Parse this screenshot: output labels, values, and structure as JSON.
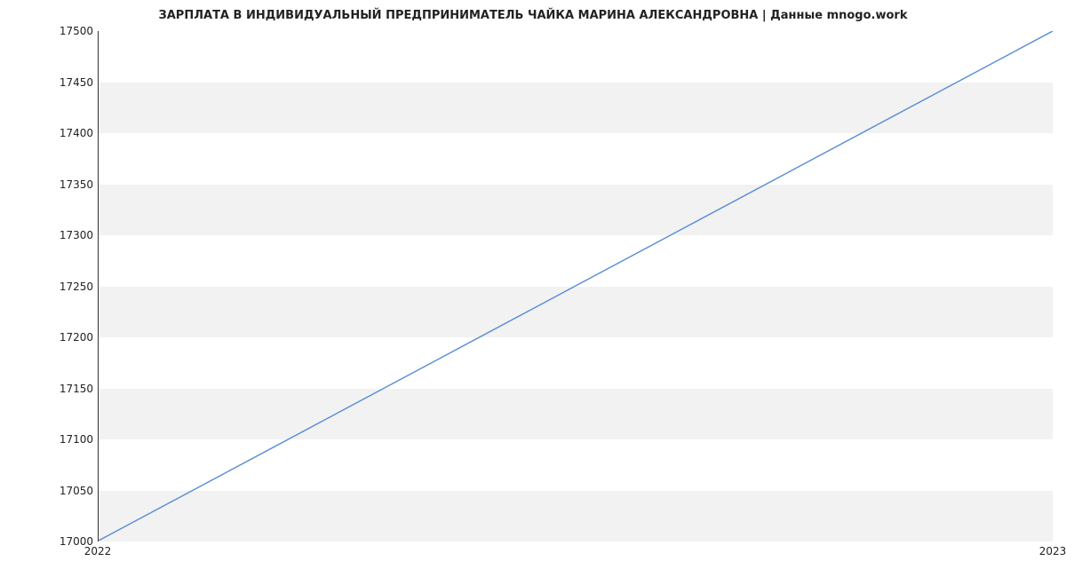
{
  "chart_data": {
    "type": "line",
    "title": "ЗАРПЛАТА В ИНДИВИДУАЛЬНЫЙ ПРЕДПРИНИМАТЕЛЬ ЧАЙКА МАРИНА АЛЕКСАНДРОВНА | Данные mnogo.work",
    "x": [
      2022,
      2023
    ],
    "values": [
      17000,
      17500
    ],
    "x_ticks": [
      2022,
      2023
    ],
    "y_ticks": [
      17000,
      17050,
      17100,
      17150,
      17200,
      17250,
      17300,
      17350,
      17400,
      17450,
      17500
    ],
    "xlim": [
      2022,
      2023
    ],
    "ylim": [
      17000,
      17500
    ],
    "line_color": "#5a8fd6",
    "band_color": "#f2f2f2"
  }
}
